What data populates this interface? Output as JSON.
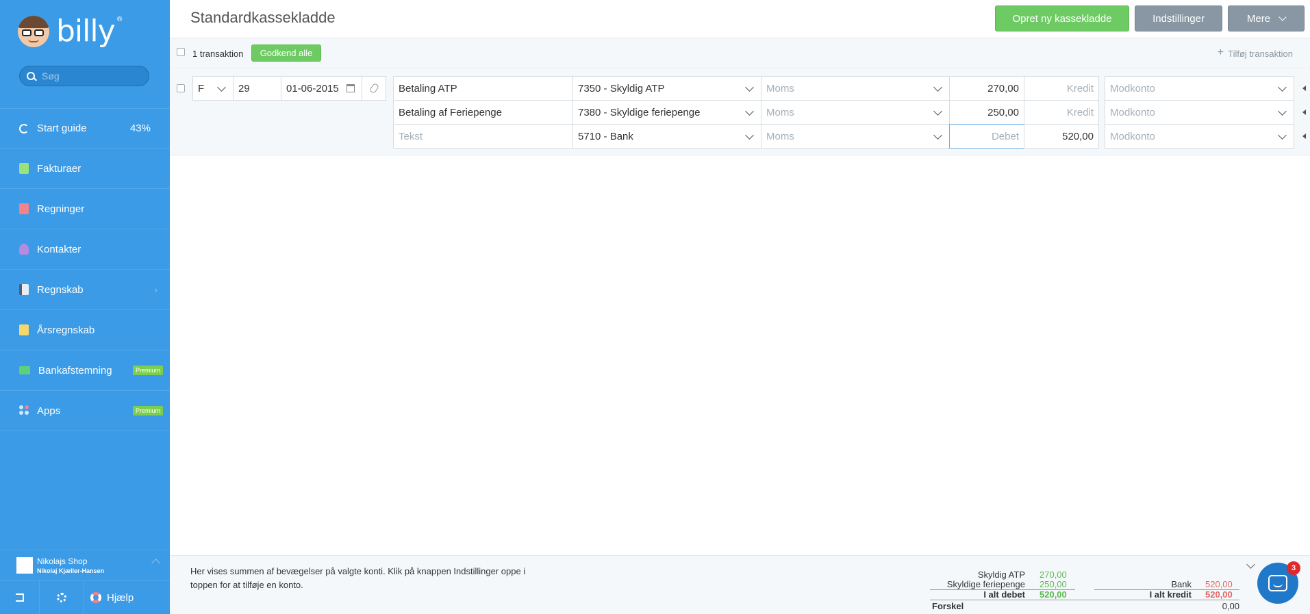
{
  "sidebar": {
    "logo": "billy",
    "logo_mark": "®",
    "search_placeholder": "Søg",
    "items": [
      {
        "label": "Start guide",
        "extra": "43%",
        "icon": "spinner-icon"
      },
      {
        "label": "Fakturaer",
        "icon": "invoice-icon"
      },
      {
        "label": "Regninger",
        "icon": "bill-icon"
      },
      {
        "label": "Kontakter",
        "icon": "contact-icon"
      },
      {
        "label": "Regnskab",
        "icon": "ledger-icon"
      },
      {
        "label": "Årsregnskab",
        "icon": "annual-report-icon"
      },
      {
        "label": "Bankafstemning",
        "badge": "Premium",
        "icon": "bank-icon"
      },
      {
        "label": "Apps",
        "badge": "Premium",
        "icon": "apps-icon"
      }
    ],
    "shop": {
      "name": "Nikolajs Shop",
      "user": "Nikolaj Kjæller-Hansen"
    },
    "help": "Hjælp"
  },
  "header": {
    "title": "Standardkassekladde",
    "new_button": "Opret ny kassekladde",
    "settings_button": "Indstillinger",
    "more_button": "Mere"
  },
  "subbar": {
    "count": "1 transaktion",
    "approve_all": "Godkend alle",
    "add_transaction": "Tilføj transaktion"
  },
  "transaction": {
    "type": "F",
    "number": "29",
    "date": "01-06-2015",
    "lines": [
      {
        "text": "Betaling ATP",
        "account": "7350 - Skyldig ATP",
        "vat": "Moms",
        "debit": "270,00",
        "credit": "Kredit",
        "contra": "Modkonto"
      },
      {
        "text": "Betaling af Feriepenge",
        "account": "7380 - Skyldige feriepenge",
        "vat": "Moms",
        "debit": "250,00",
        "credit": "Kredit",
        "contra": "Modkonto"
      },
      {
        "text": "Tekst",
        "account": "5710 - Bank",
        "vat": "Moms",
        "debit": "Debet",
        "credit": "520,00",
        "contra": "Modkonto"
      }
    ]
  },
  "footer": {
    "text": "Her vises summen af bevægelser på valgte konti. Klik på knappen Indstillinger oppe i toppen for at tilføje en konto.",
    "debit_rows": [
      {
        "label": "Skyldig ATP",
        "value": "270,00"
      },
      {
        "label": "Skyldige feriepenge",
        "value": "250,00"
      }
    ],
    "debit_total": {
      "label": "I alt debet",
      "value": "520,00"
    },
    "credit_rows": [
      {
        "label": "Bank",
        "value": "520,00"
      }
    ],
    "credit_total": {
      "label": "I alt kredit",
      "value": "520,00"
    },
    "difference": {
      "label": "Forskel",
      "value": "0,00"
    }
  },
  "chat": {
    "badge": "3"
  },
  "colors": {
    "sidebar": "#3b9be6",
    "primary_green": "#6ecb64",
    "gray_button": "#8997a4",
    "debit_green": "#5ab851",
    "credit_red": "#e06666"
  }
}
